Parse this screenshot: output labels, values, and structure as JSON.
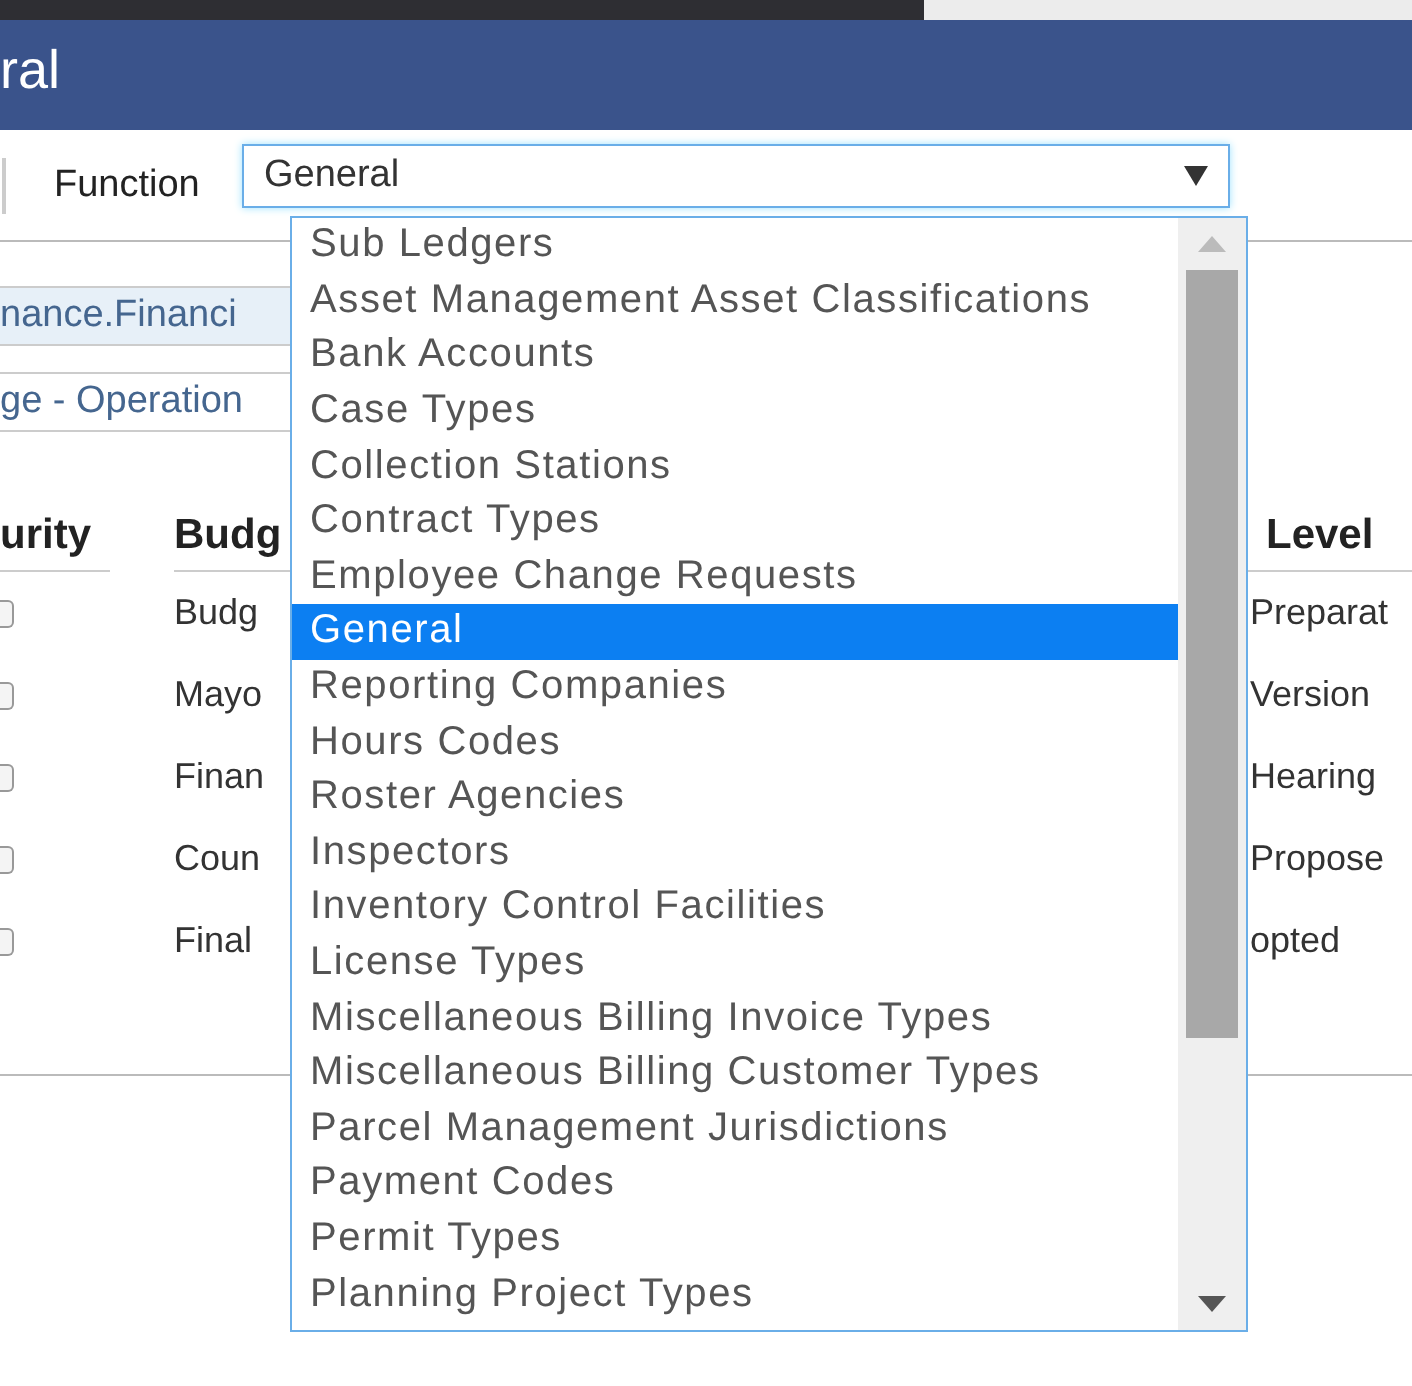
{
  "header": {
    "title": "ral"
  },
  "toolbar": {
    "label": "Function",
    "select": {
      "value": "General",
      "expanded": true
    }
  },
  "fields": [
    {
      "value": "nance.Financi",
      "highlighted": true
    },
    {
      "value": "ge - Operation",
      "highlighted": false
    }
  ],
  "table": {
    "columns": [
      "urity",
      "Budg",
      "Level"
    ],
    "rows": [
      {
        "checked": false,
        "column_2": "Budg",
        "level": "Preparat"
      },
      {
        "checked": false,
        "column_2": "Mayo",
        "level": "Version"
      },
      {
        "checked": false,
        "column_2": "Finan",
        "level": "Hearing"
      },
      {
        "checked": false,
        "column_2": "Coun",
        "level": "Propose"
      },
      {
        "checked": false,
        "column_2": "Final",
        "level": "opted"
      }
    ]
  },
  "dropdown": {
    "options": [
      {
        "label": "Sub Ledgers",
        "selected": false
      },
      {
        "label": "Asset Management Asset Classifications",
        "selected": false
      },
      {
        "label": "Bank Accounts",
        "selected": false
      },
      {
        "label": "Case Types",
        "selected": false
      },
      {
        "label": "Collection Stations",
        "selected": false
      },
      {
        "label": "Contract Types",
        "selected": false
      },
      {
        "label": "Employee Change Requests",
        "selected": false
      },
      {
        "label": "General",
        "selected": true
      },
      {
        "label": "Reporting Companies",
        "selected": false
      },
      {
        "label": "Hours Codes",
        "selected": false
      },
      {
        "label": "Roster Agencies",
        "selected": false
      },
      {
        "label": "Inspectors",
        "selected": false
      },
      {
        "label": "Inventory Control Facilities",
        "selected": false
      },
      {
        "label": "License Types",
        "selected": false
      },
      {
        "label": "Miscellaneous Billing Invoice Types",
        "selected": false
      },
      {
        "label": "Miscellaneous Billing Customer Types",
        "selected": false
      },
      {
        "label": "Parcel Management Jurisdictions",
        "selected": false
      },
      {
        "label": "Payment Codes",
        "selected": false
      },
      {
        "label": "Permit Types",
        "selected": false
      },
      {
        "label": "Planning Project Types",
        "selected": false
      }
    ]
  }
}
